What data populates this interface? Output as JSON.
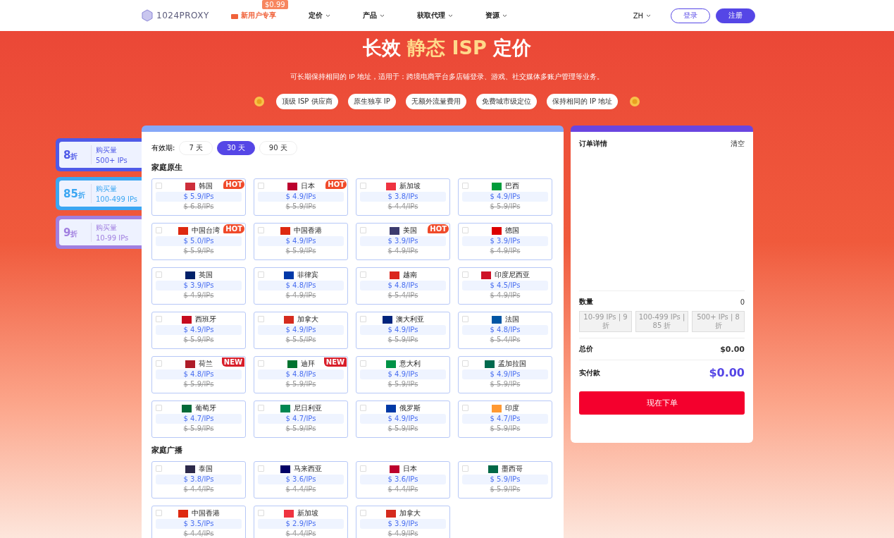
{
  "nav": {
    "logo": "1024PROXY",
    "promo": {
      "label": "新用户专享",
      "badge": "$0.99"
    },
    "menu": [
      {
        "label": "定价"
      },
      {
        "label": "产品"
      },
      {
        "label": "获取代理"
      },
      {
        "label": "资源"
      }
    ],
    "language": "ZH",
    "login": "登录",
    "register": "注册"
  },
  "hero": {
    "title_plain": "长效",
    "title_accent": "静态 ISP",
    "title_end": "定价",
    "subtitle": "可长期保持相同的 IP 地址，适用于：跨境电商平台多店铺登录、游戏、社交媒体多账户管理等业务。",
    "features": [
      "顶级 ISP 供应商",
      "原生独享 IP",
      "无额外流量费用",
      "免费城市级定位",
      "保持相同的 IP 地址"
    ]
  },
  "discounts": [
    {
      "rate": "8",
      "unit": "折",
      "caption": "购买量",
      "range": "500+ IPs",
      "color": "#4f5ae8"
    },
    {
      "rate": "85",
      "unit": "折",
      "caption": "购买量",
      "range": "100-499 IPs",
      "color": "#3ba6f2"
    },
    {
      "rate": "9",
      "unit": "折",
      "caption": "购买量",
      "range": "10-99 IPs",
      "color": "#a07fe0"
    }
  ],
  "validity": {
    "label": "有效期:",
    "options": [
      {
        "label": "7 天",
        "selected": false
      },
      {
        "label": "30 天",
        "selected": true
      },
      {
        "label": "90 天",
        "selected": false
      }
    ]
  },
  "sections": [
    {
      "title": "家庭原生",
      "items": [
        {
          "name": "韩国",
          "price": "$ 5.9/IPs",
          "old": "$ 6.8/IPs",
          "checked": false,
          "color": "#cd2e3a",
          "badge": {
            "kind": "hot",
            "label": "HOT"
          }
        },
        {
          "name": "日本",
          "price": "$ 4.9/IPs",
          "old": "$ 5.9/IPs",
          "checked": false,
          "color": "#bc002d",
          "badge": {
            "kind": "hot",
            "label": "HOT"
          }
        },
        {
          "name": "新加坡",
          "price": "$ 3.8/IPs",
          "old": "$ 4.4/IPs",
          "checked": false,
          "color": "#ef3340"
        },
        {
          "name": "巴西",
          "price": "$ 4.9/IPs",
          "old": "$ 5.9/IPs",
          "checked": false,
          "color": "#009c3b"
        },
        {
          "name": "中国台湾",
          "price": "$ 5.0/IPs",
          "old": "$ 5.9/IPs",
          "checked": false,
          "color": "#de2910",
          "badge": {
            "kind": "hot",
            "label": "HOT"
          }
        },
        {
          "name": "中国香港",
          "price": "$ 4.9/IPs",
          "old": "$ 5.9/IPs",
          "checked": false,
          "color": "#de2910"
        },
        {
          "name": "美国",
          "price": "$ 3.9/IPs",
          "old": "$ 4.9/IPs",
          "checked": false,
          "color": "#3c3b6e",
          "badge": {
            "kind": "hot",
            "label": "HOT"
          }
        },
        {
          "name": "德国",
          "price": "$ 3.9/IPs",
          "old": "$ 4.9/IPs",
          "checked": false,
          "color": "#dd0000"
        },
        {
          "name": "英国",
          "price": "$ 3.9/IPs",
          "old": "$ 4.9/IPs",
          "checked": false,
          "color": "#012169"
        },
        {
          "name": "菲律宾",
          "price": "$ 4.8/IPs",
          "old": "$ 4.9/IPs",
          "checked": false,
          "color": "#0038a8"
        },
        {
          "name": "越南",
          "price": "$ 4.8/IPs",
          "old": "$ 5.4/IPs",
          "checked": false,
          "color": "#da251d"
        },
        {
          "name": "印度尼西亚",
          "price": "$ 4.5/IPs",
          "old": "$ 4.9/IPs",
          "checked": false,
          "color": "#ce1126"
        },
        {
          "name": "西班牙",
          "price": "$ 4.9/IPs",
          "old": "$ 5.9/IPs",
          "checked": false,
          "color": "#c60b1e"
        },
        {
          "name": "加拿大",
          "price": "$ 4.9/IPs",
          "old": "$ 5.5/IPs",
          "checked": false,
          "color": "#d52b1e"
        },
        {
          "name": "澳大利亚",
          "price": "$ 4.9/IPs",
          "old": "$ 5.9/IPs",
          "checked": false,
          "color": "#00247d"
        },
        {
          "name": "法国",
          "price": "$ 4.8/IPs",
          "old": "$ 5.4/IPs",
          "checked": false,
          "color": "#0055a4"
        },
        {
          "name": "荷兰",
          "price": "$ 4.8/IPs",
          "old": "$ 5.9/IPs",
          "checked": false,
          "color": "#ae1c28",
          "badge": {
            "kind": "new",
            "label": "NEW"
          }
        },
        {
          "name": "迪拜",
          "price": "$ 4.8/IPs",
          "old": "$ 5.9/IPs",
          "checked": false,
          "color": "#00732f",
          "badge": {
            "kind": "new",
            "label": "NEW"
          }
        },
        {
          "name": "意大利",
          "price": "$ 4.9/IPs",
          "old": "$ 5.9/IPs",
          "checked": false,
          "color": "#009246"
        },
        {
          "name": "孟加拉国",
          "price": "$ 4.9/IPs",
          "old": "$ 5.9/IPs",
          "checked": false,
          "color": "#006a4e"
        },
        {
          "name": "葡萄牙",
          "price": "$ 4.7/IPs",
          "old": "$ 5.9/IPs",
          "checked": false,
          "color": "#046a38"
        },
        {
          "name": "尼日利亚",
          "price": "$ 4.7/IPs",
          "old": "$ 5.9/IPs",
          "checked": false,
          "color": "#008751"
        },
        {
          "name": "俄罗斯",
          "price": "$ 4.9/IPs",
          "old": "$ 5.9/IPs",
          "checked": false,
          "color": "#0039a6"
        },
        {
          "name": "印度",
          "price": "$ 4.7/IPs",
          "old": "$ 5.9/IPs",
          "checked": false,
          "color": "#ff9933"
        }
      ]
    },
    {
      "title": "家庭广播",
      "items": [
        {
          "name": "泰国",
          "price": "$ 3.8/IPs",
          "old": "$ 4.4/IPs",
          "checked": false,
          "color": "#2d2a4a"
        },
        {
          "name": "马来西亚",
          "price": "$ 3.6/IPs",
          "old": "$ 4.4/IPs",
          "checked": false,
          "color": "#010066"
        },
        {
          "name": "日本",
          "price": "$ 3.6/IPs",
          "old": "$ 4.4/IPs",
          "checked": false,
          "color": "#bc002d"
        },
        {
          "name": "墨西哥",
          "price": "$ 5.9/IPs",
          "old": "$ 5.9/IPs",
          "checked": false,
          "color": "#006847"
        },
        {
          "name": "中国香港",
          "price": "$ 3.5/IPs",
          "old": "$ 4.4/IPs",
          "checked": false,
          "color": "#de2910"
        },
        {
          "name": "新加坡",
          "price": "$ 2.9/IPs",
          "old": "$ 4.4/IPs",
          "checked": false,
          "color": "#ef3340"
        },
        {
          "name": "加拿大",
          "price": "$ 3.9/IPs",
          "old": "$ 4.9/IPs",
          "checked": false,
          "color": "#d52b1e"
        }
      ]
    }
  ],
  "order": {
    "title": "订单详情",
    "clear": "清空",
    "quantity_label": "数量",
    "quantity": "0",
    "tiers": [
      "10-99 IPs | 9 折",
      "100-499 IPs | 85 折",
      "500+ IPs | 8 折"
    ],
    "total_label": "总价",
    "total": "$0.00",
    "pay_label": "实付款",
    "pay": "$0.00",
    "submit": "现在下单"
  }
}
